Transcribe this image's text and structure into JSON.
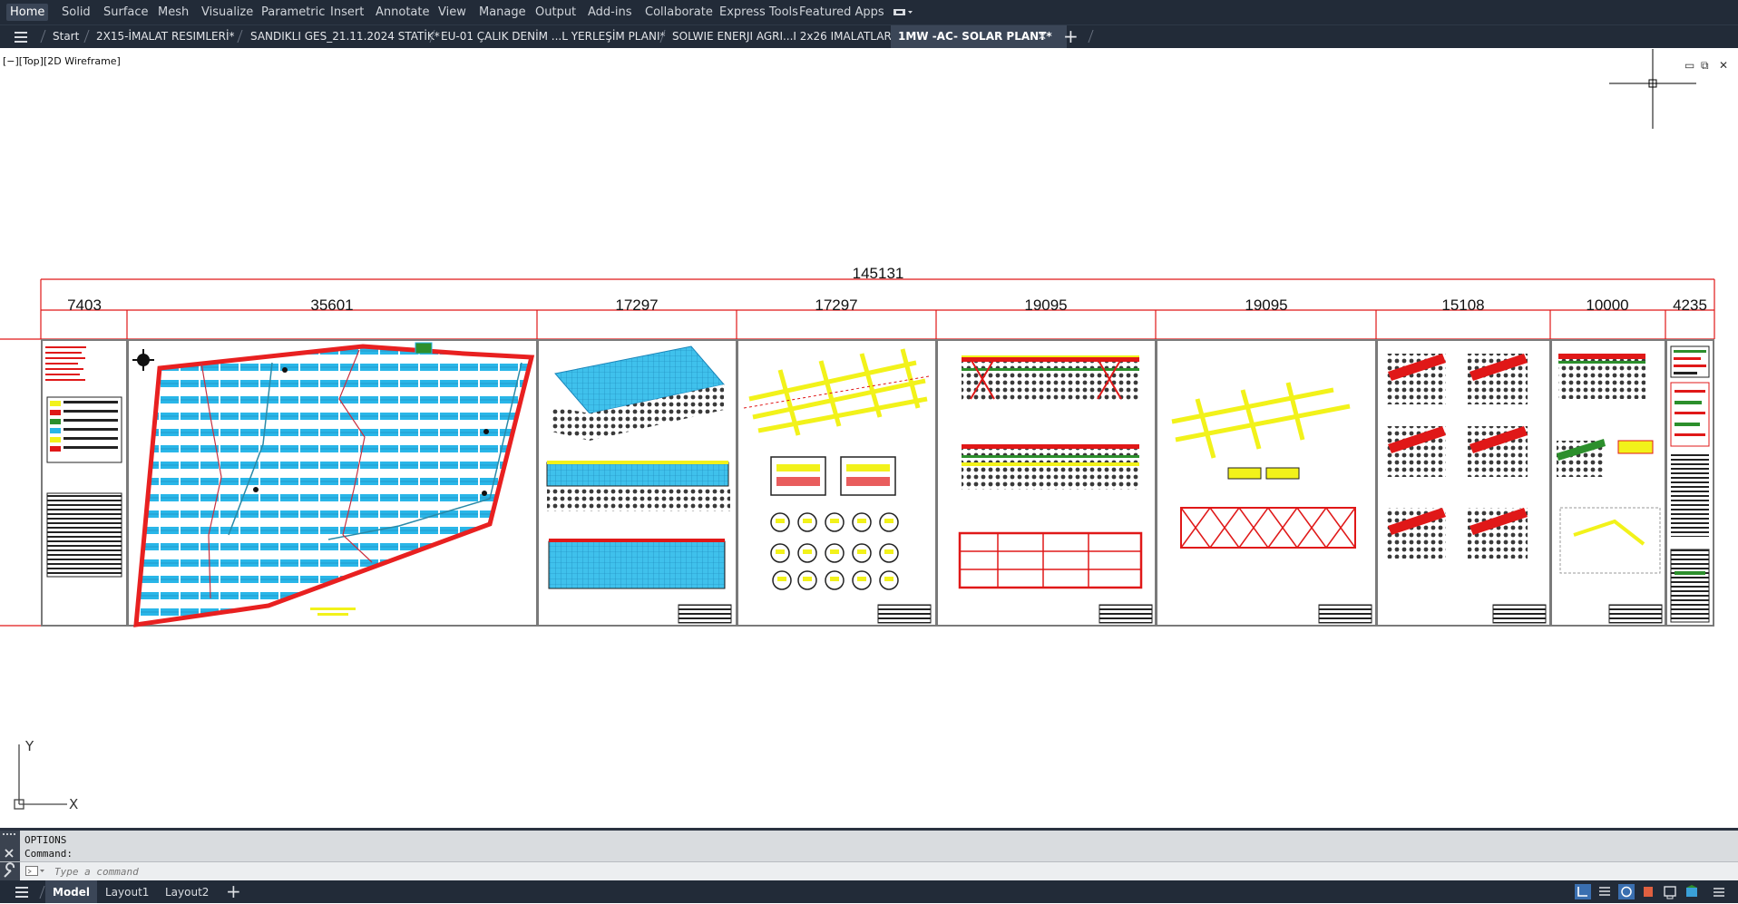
{
  "ribbon_tabs": [
    "Home",
    "Solid",
    "Surface",
    "Mesh",
    "Visualize",
    "Parametric",
    "Insert",
    "Annotate",
    "View",
    "Manage",
    "Output",
    "Add-ins",
    "Collaborate",
    "Express Tools",
    "Featured Apps"
  ],
  "file_tabs": {
    "start": "Start",
    "files": [
      "2X15-İMALAT RESIMLERİ*",
      "SANDIKLI GES_21.11.2024 STATİK*",
      "EU-01 ÇALIK DENİM ...L YERLEŞİM PLANI*",
      "SOLWIE ENERJI AGRI...I 2x26 IMALATLAR*",
      "1MW -AC- SOLAR PLANT*"
    ],
    "close_glyph": "✕",
    "new_tab_glyph": "+"
  },
  "viewport": {
    "label": "[−][Top][2D Wireframe]",
    "controls": [
      "▭",
      "⧉",
      "✕"
    ]
  },
  "drawing": {
    "total_dimension": "145131",
    "sheet_dimensions": [
      "7403",
      "35601",
      "17297",
      "17297",
      "19095",
      "19095",
      "15108",
      "10000",
      "4235"
    ]
  },
  "ucs": {
    "x_label": "X",
    "y_label": "Y"
  },
  "command": {
    "history": [
      "OPTIONS",
      "Command:"
    ],
    "placeholder": "Type a command"
  },
  "layout_tabs": [
    "Model",
    "Layout1",
    "Layout2"
  ],
  "layout_add_glyph": "+",
  "colors": {
    "ui_dark": "#222b38",
    "active_tab": "#3b4657",
    "dimension_red": "#e01818",
    "panel_cyan": "#29b6e8",
    "structure_yellow": "#f2f21a"
  }
}
